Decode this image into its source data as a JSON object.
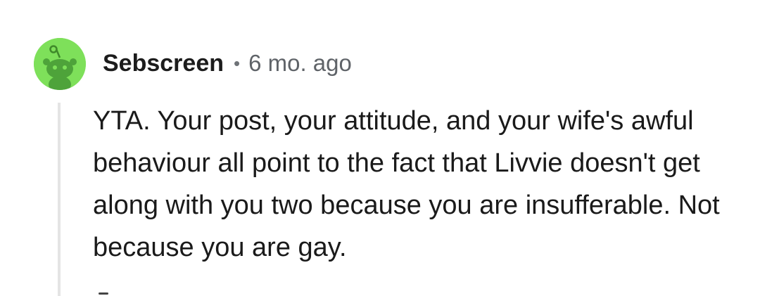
{
  "comment": {
    "author": "Sebscreen",
    "separator": "•",
    "age": "6 mo. ago",
    "avatar_icon": "snoo-avatar-icon",
    "avatar_color": "#7ee05a",
    "text": "YTA. Your post, your attitude, and your wife's awful behaviour all point to the fact that Livvie doesn't get along with you two because you are insufferable. Not because you are gay."
  }
}
